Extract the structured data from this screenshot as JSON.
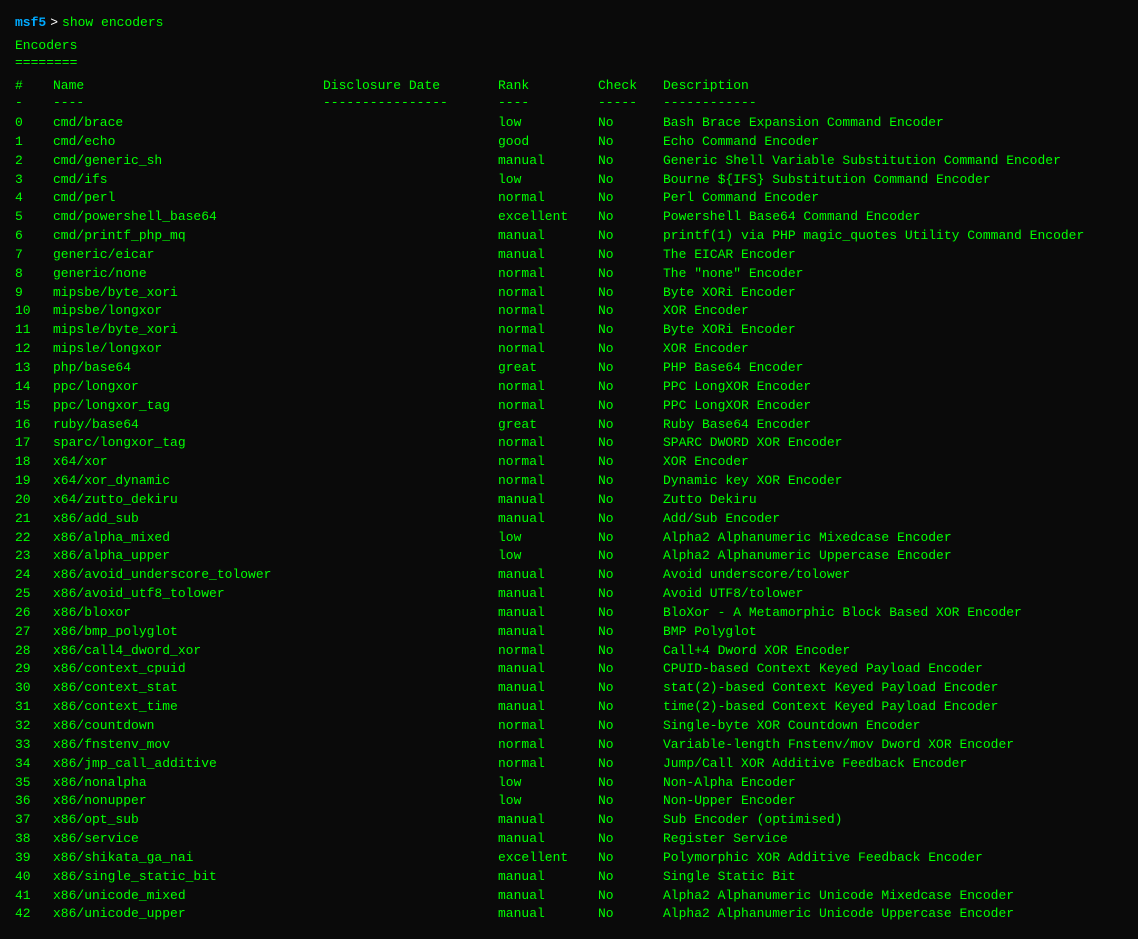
{
  "terminal": {
    "prompt": "msf5",
    "arrow": ">",
    "command": "show encoders",
    "section_title": "Encoders",
    "section_sep": "========",
    "header": {
      "num": "#",
      "name": "Name",
      "date": "Disclosure Date",
      "rank": "Rank",
      "check": "Check",
      "desc": "Description"
    },
    "header_div": {
      "num": "-",
      "name": "----",
      "date": "----------------",
      "rank": "----",
      "check": "-----",
      "desc": "------------"
    },
    "rows": [
      {
        "num": "0",
        "name": "cmd/brace",
        "date": "",
        "rank": "low",
        "check": "No",
        "desc": "Bash Brace Expansion Command Encoder"
      },
      {
        "num": "1",
        "name": "cmd/echo",
        "date": "",
        "rank": "good",
        "check": "No",
        "desc": "Echo Command Encoder"
      },
      {
        "num": "2",
        "name": "cmd/generic_sh",
        "date": "",
        "rank": "manual",
        "check": "No",
        "desc": "Generic Shell Variable Substitution Command Encoder"
      },
      {
        "num": "3",
        "name": "cmd/ifs",
        "date": "",
        "rank": "low",
        "check": "No",
        "desc": "Bourne ${IFS} Substitution Command Encoder"
      },
      {
        "num": "4",
        "name": "cmd/perl",
        "date": "",
        "rank": "normal",
        "check": "No",
        "desc": "Perl Command Encoder"
      },
      {
        "num": "5",
        "name": "cmd/powershell_base64",
        "date": "",
        "rank": "excellent",
        "check": "No",
        "desc": "Powershell Base64 Command Encoder"
      },
      {
        "num": "6",
        "name": "cmd/printf_php_mq",
        "date": "",
        "rank": "manual",
        "check": "No",
        "desc": "printf(1) via PHP magic_quotes Utility Command Encoder"
      },
      {
        "num": "7",
        "name": "generic/eicar",
        "date": "",
        "rank": "manual",
        "check": "No",
        "desc": "The EICAR Encoder"
      },
      {
        "num": "8",
        "name": "generic/none",
        "date": "",
        "rank": "normal",
        "check": "No",
        "desc": "The \"none\" Encoder"
      },
      {
        "num": "9",
        "name": "mipsbe/byte_xori",
        "date": "",
        "rank": "normal",
        "check": "No",
        "desc": "Byte XORi Encoder"
      },
      {
        "num": "10",
        "name": "mipsbe/longxor",
        "date": "",
        "rank": "normal",
        "check": "No",
        "desc": "XOR Encoder"
      },
      {
        "num": "11",
        "name": "mipsle/byte_xori",
        "date": "",
        "rank": "normal",
        "check": "No",
        "desc": "Byte XORi Encoder"
      },
      {
        "num": "12",
        "name": "mipsle/longxor",
        "date": "",
        "rank": "normal",
        "check": "No",
        "desc": "XOR Encoder"
      },
      {
        "num": "13",
        "name": "php/base64",
        "date": "",
        "rank": "great",
        "check": "No",
        "desc": "PHP Base64 Encoder"
      },
      {
        "num": "14",
        "name": "ppc/longxor",
        "date": "",
        "rank": "normal",
        "check": "No",
        "desc": "PPC LongXOR Encoder"
      },
      {
        "num": "15",
        "name": "ppc/longxor_tag",
        "date": "",
        "rank": "normal",
        "check": "No",
        "desc": "PPC LongXOR Encoder"
      },
      {
        "num": "16",
        "name": "ruby/base64",
        "date": "",
        "rank": "great",
        "check": "No",
        "desc": "Ruby Base64 Encoder"
      },
      {
        "num": "17",
        "name": "sparc/longxor_tag",
        "date": "",
        "rank": "normal",
        "check": "No",
        "desc": "SPARC DWORD XOR Encoder"
      },
      {
        "num": "18",
        "name": "x64/xor",
        "date": "",
        "rank": "normal",
        "check": "No",
        "desc": "XOR Encoder"
      },
      {
        "num": "19",
        "name": "x64/xor_dynamic",
        "date": "",
        "rank": "normal",
        "check": "No",
        "desc": "Dynamic key XOR Encoder"
      },
      {
        "num": "20",
        "name": "x64/zutto_dekiru",
        "date": "",
        "rank": "manual",
        "check": "No",
        "desc": "Zutto Dekiru"
      },
      {
        "num": "21",
        "name": "x86/add_sub",
        "date": "",
        "rank": "manual",
        "check": "No",
        "desc": "Add/Sub Encoder"
      },
      {
        "num": "22",
        "name": "x86/alpha_mixed",
        "date": "",
        "rank": "low",
        "check": "No",
        "desc": "Alpha2 Alphanumeric Mixedcase Encoder"
      },
      {
        "num": "23",
        "name": "x86/alpha_upper",
        "date": "",
        "rank": "low",
        "check": "No",
        "desc": "Alpha2 Alphanumeric Uppercase Encoder"
      },
      {
        "num": "24",
        "name": "x86/avoid_underscore_tolower",
        "date": "",
        "rank": "manual",
        "check": "No",
        "desc": "Avoid underscore/tolower"
      },
      {
        "num": "25",
        "name": "x86/avoid_utf8_tolower",
        "date": "",
        "rank": "manual",
        "check": "No",
        "desc": "Avoid UTF8/tolower"
      },
      {
        "num": "26",
        "name": "x86/bloxor",
        "date": "",
        "rank": "manual",
        "check": "No",
        "desc": "BloXor - A Metamorphic Block Based XOR Encoder"
      },
      {
        "num": "27",
        "name": "x86/bmp_polyglot",
        "date": "",
        "rank": "manual",
        "check": "No",
        "desc": "BMP Polyglot"
      },
      {
        "num": "28",
        "name": "x86/call4_dword_xor",
        "date": "",
        "rank": "normal",
        "check": "No",
        "desc": "Call+4 Dword XOR Encoder"
      },
      {
        "num": "29",
        "name": "x86/context_cpuid",
        "date": "",
        "rank": "manual",
        "check": "No",
        "desc": "CPUID-based Context Keyed Payload Encoder"
      },
      {
        "num": "30",
        "name": "x86/context_stat",
        "date": "",
        "rank": "manual",
        "check": "No",
        "desc": "stat(2)-based Context Keyed Payload Encoder"
      },
      {
        "num": "31",
        "name": "x86/context_time",
        "date": "",
        "rank": "manual",
        "check": "No",
        "desc": "time(2)-based Context Keyed Payload Encoder"
      },
      {
        "num": "32",
        "name": "x86/countdown",
        "date": "",
        "rank": "normal",
        "check": "No",
        "desc": "Single-byte XOR Countdown Encoder"
      },
      {
        "num": "33",
        "name": "x86/fnstenv_mov",
        "date": "",
        "rank": "normal",
        "check": "No",
        "desc": "Variable-length Fnstenv/mov Dword XOR Encoder"
      },
      {
        "num": "34",
        "name": "x86/jmp_call_additive",
        "date": "",
        "rank": "normal",
        "check": "No",
        "desc": "Jump/Call XOR Additive Feedback Encoder"
      },
      {
        "num": "35",
        "name": "x86/nonalpha",
        "date": "",
        "rank": "low",
        "check": "No",
        "desc": "Non-Alpha Encoder"
      },
      {
        "num": "36",
        "name": "x86/nonupper",
        "date": "",
        "rank": "low",
        "check": "No",
        "desc": "Non-Upper Encoder"
      },
      {
        "num": "37",
        "name": "x86/opt_sub",
        "date": "",
        "rank": "manual",
        "check": "No",
        "desc": "Sub Encoder (optimised)"
      },
      {
        "num": "38",
        "name": "x86/service",
        "date": "",
        "rank": "manual",
        "check": "No",
        "desc": "Register Service"
      },
      {
        "num": "39",
        "name": "x86/shikata_ga_nai",
        "date": "",
        "rank": "excellent",
        "check": "No",
        "desc": "Polymorphic XOR Additive Feedback Encoder"
      },
      {
        "num": "40",
        "name": "x86/single_static_bit",
        "date": "",
        "rank": "manual",
        "check": "No",
        "desc": "Single Static Bit"
      },
      {
        "num": "41",
        "name": "x86/unicode_mixed",
        "date": "",
        "rank": "manual",
        "check": "No",
        "desc": "Alpha2 Alphanumeric Unicode Mixedcase Encoder"
      },
      {
        "num": "42",
        "name": "x86/unicode_upper",
        "date": "",
        "rank": "manual",
        "check": "No",
        "desc": "Alpha2 Alphanumeric Unicode Uppercase Encoder"
      }
    ]
  }
}
